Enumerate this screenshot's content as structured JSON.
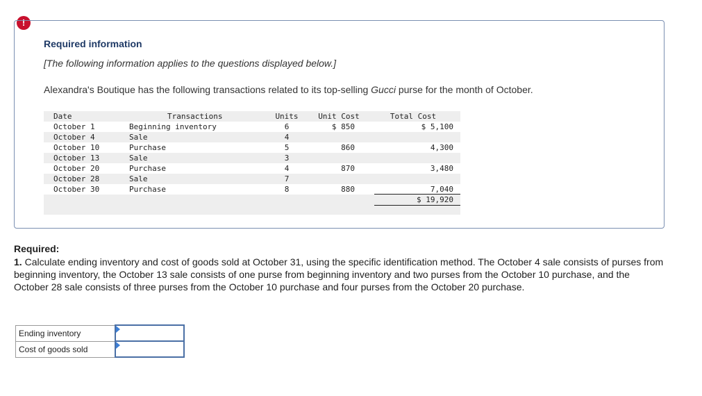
{
  "alert": {
    "symbol": "!"
  },
  "info": {
    "title": "Required information",
    "note": "[The following information applies to the questions displayed below.]",
    "desc_prefix": "Alexandra's Boutique has the following transactions related to its top-selling ",
    "desc_brand": "Gucci",
    "desc_suffix": " purse for the month of October."
  },
  "table": {
    "headers": {
      "date": "Date",
      "transactions": "Transactions",
      "units": "Units",
      "unit_cost": "Unit Cost",
      "total_cost": "Total Cost"
    },
    "rows": [
      {
        "date": "October 1",
        "desc": "Beginning inventory",
        "units": "6",
        "unit_cost": "$ 850",
        "total_cost": "$ 5,100"
      },
      {
        "date": "October 4",
        "desc": "Sale",
        "units": "4",
        "unit_cost": "",
        "total_cost": ""
      },
      {
        "date": "October 10",
        "desc": "Purchase",
        "units": "5",
        "unit_cost": "860",
        "total_cost": "4,300"
      },
      {
        "date": "October 13",
        "desc": "Sale",
        "units": "3",
        "unit_cost": "",
        "total_cost": ""
      },
      {
        "date": "October 20",
        "desc": "Purchase",
        "units": "4",
        "unit_cost": "870",
        "total_cost": "3,480"
      },
      {
        "date": "October 28",
        "desc": "Sale",
        "units": "7",
        "unit_cost": "",
        "total_cost": ""
      },
      {
        "date": "October 30",
        "desc": "Purchase",
        "units": "8",
        "unit_cost": "880",
        "total_cost": "7,040"
      }
    ],
    "grand_total": "$ 19,920"
  },
  "required": {
    "label": "Required:",
    "number": "1.",
    "text": " Calculate ending inventory and cost of goods sold at October 31, using the specific identification method. The October 4 sale consists of purses from beginning inventory, the October 13 sale consists of one purse from beginning inventory and two purses from the October 10 purchase, and the October 28 sale consists of three purses from the October 10 purchase and four purses from the October 20 purchase."
  },
  "answers": {
    "rows": [
      {
        "label": "Ending inventory",
        "value": ""
      },
      {
        "label": "Cost of goods sold",
        "value": ""
      }
    ]
  }
}
